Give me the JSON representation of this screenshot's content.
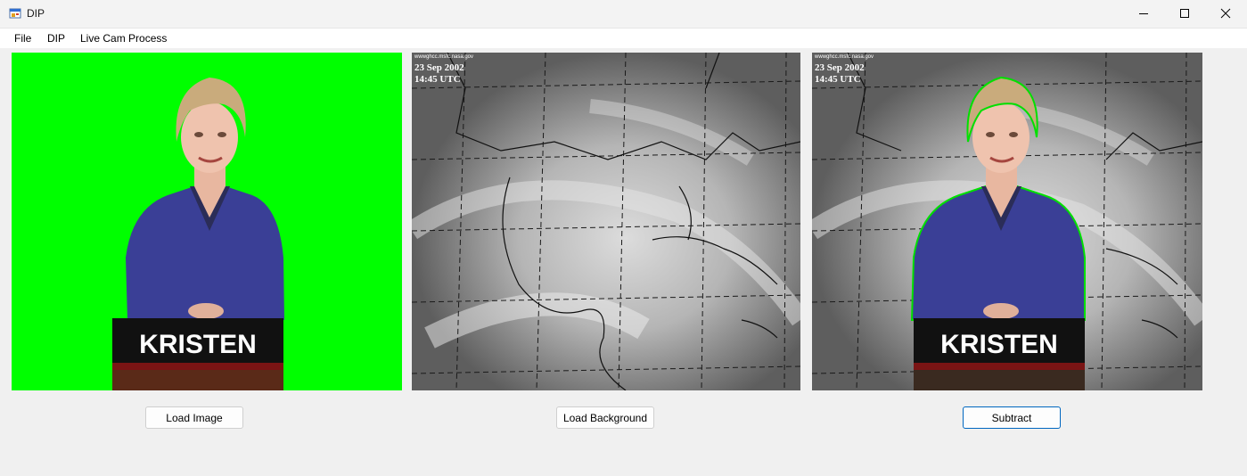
{
  "window": {
    "title": "DIP",
    "icons": [
      "app-icon",
      "minimize-icon",
      "maximize-icon",
      "close-icon"
    ]
  },
  "menu": {
    "items": [
      {
        "label": "File"
      },
      {
        "label": "DIP"
      },
      {
        "label": "Live Cam Process"
      }
    ]
  },
  "images": {
    "source": {
      "caption": "KRISTEN",
      "background_color": "#00ff00"
    },
    "background": {
      "watermark": "wwwghcc.msfc.nasa.gov",
      "date": "23 Sep 2002",
      "time": "14:45 UTC"
    },
    "result": {
      "watermark": "wwwghcc.msfc.nasa.gov",
      "date": "23 Sep 2002",
      "time": "14:45 UTC",
      "caption": "KRISTEN",
      "outline_color": "#00e000"
    }
  },
  "buttons": {
    "load_image": "Load Image",
    "load_background": "Load Background",
    "subtract": "Subtract"
  }
}
